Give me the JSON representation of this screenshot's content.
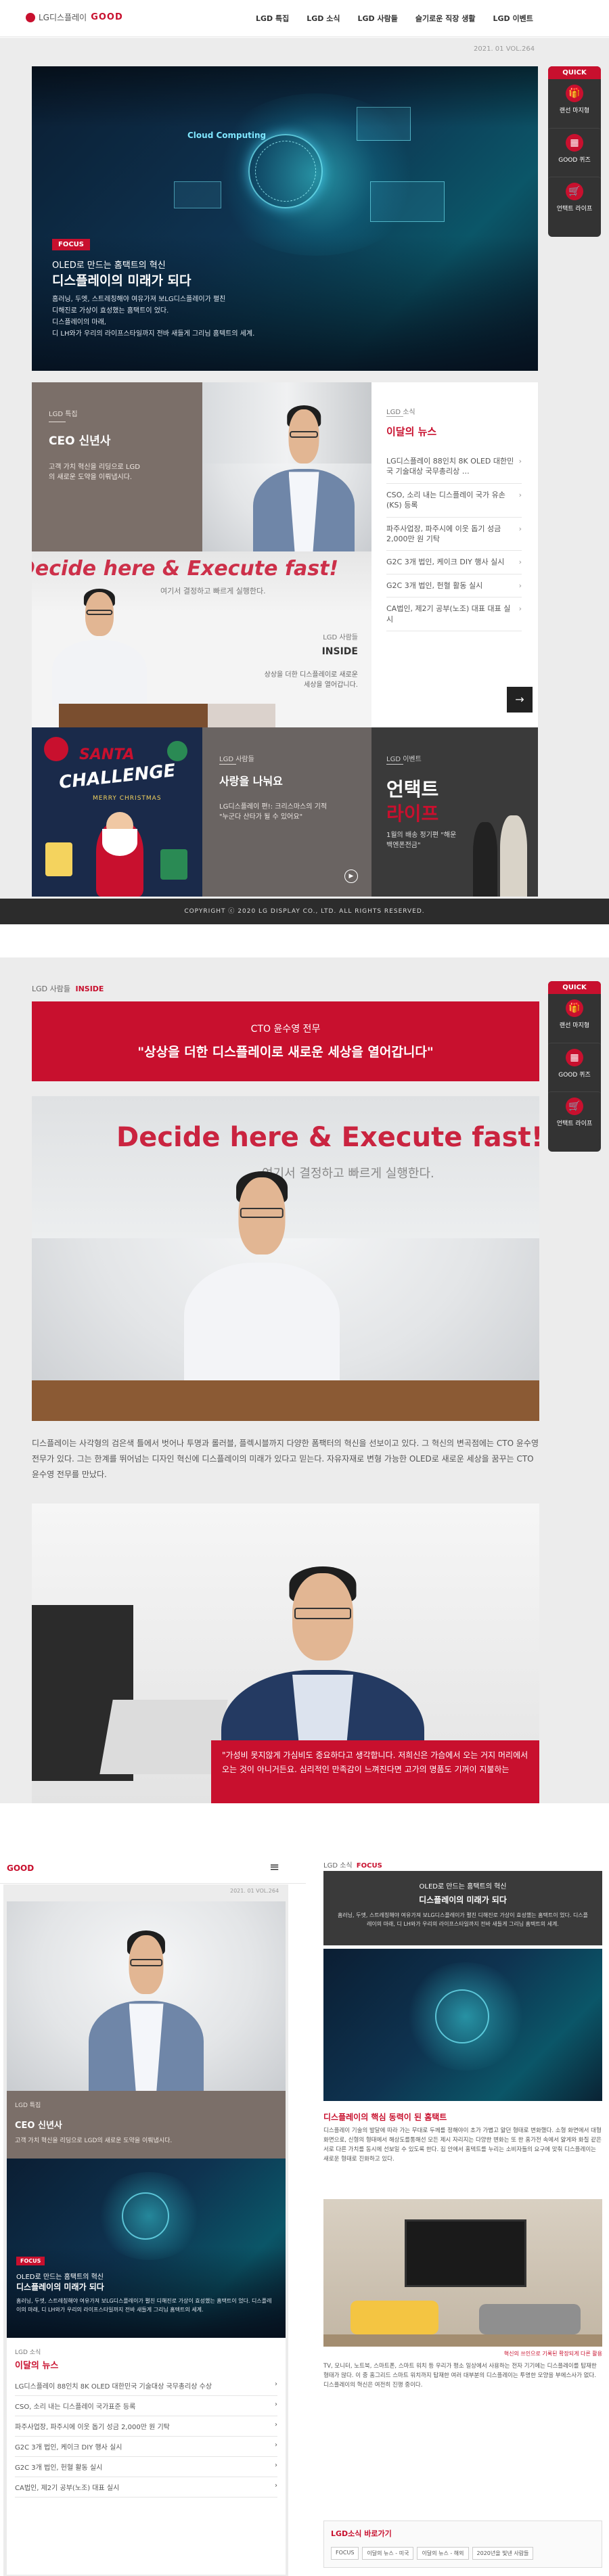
{
  "header": {
    "logo": "LG디스플레이",
    "brand": "GOOD",
    "nav": [
      "LGD 특집",
      "LGD 소식",
      "LGD 사람들",
      "슬기로운 직장 생활",
      "LGD 이벤트"
    ]
  },
  "vol": "2021. 01 VOL.264",
  "quick": {
    "title": "QUICK",
    "items": [
      "랜선 마지형",
      "GOOD 퀴즈",
      "언택트 라이프"
    ]
  },
  "hero": {
    "badge": "FOCUS",
    "cloud": "Cloud Computing",
    "title1": "OLED로 만드는 홈택트의 혁신",
    "title2": "디스플레이의 미래가 되다",
    "desc": [
      "홈러닝, 두엣, 스트레칭해야 여유가져 보LG디스플레이가 펼친",
      "디해진로 가상이 효성했는 홈택트이 었다.",
      "디스플레이의 마래,",
      "디 LH와가 우리의 라이프스타일까지 전바 새들게 그리님 홈텍트의 세계."
    ]
  },
  "tile_ceo": {
    "cat": "LGD 특집",
    "title": "CEO 신년사",
    "desc": "고객 가치 혁신을 리딩으로 LGD의 새로운 도약을 이뤄냅시다."
  },
  "news": {
    "cat": "LGD 소식",
    "title": "이달의 뉴스",
    "items": [
      "LG디스플레이 88인치 8K OLED 대한민국 기술대상 국무총리상 …",
      "CSO, 소리 내는 디스플레이 국가 유손(KS) 등록",
      "파주사업장, 파주시에 이웃 돕기 성금 2,000만 원 기탁",
      "G2C 3개 법인, 케이크 DIY 행사 실시",
      "G2C 3개 법인, 헌혈 활동 실시",
      "CA법인, 제2기 공부(노조) 대표 대표 실시"
    ]
  },
  "inside": {
    "cat": "LGD 사람들",
    "title": "INSIDE",
    "desc": "상상을 더한 디스플레이로 새로운 세상을 열어갑니다.",
    "sign": "Decide here & Execute fast!",
    "sign_sub": "여기서 결정하고 빠르게 실행한다."
  },
  "santa": {
    "l1": "SANTA",
    "l2": "CHALLENGE",
    "l3": "MERRY CHRISTMAS"
  },
  "say": {
    "cat": "LGD 사람들",
    "title": "사랑을 나눠요",
    "desc": "LG디스플레이 편!: 크리스마스의 기적 \"누군다 산타가 될 수 있어요\""
  },
  "untact": {
    "cat": "LGD 이벤트",
    "l1": "언택트",
    "l2": "라이프",
    "desc": "1월의 배송 정기편 \"해운백엔폰전금\""
  },
  "footer": {
    "copy": "COPYRIGHT ⓒ 2020 LG DISPLAY CO., LTD. ALL RIGHTS RESERVED."
  },
  "article": {
    "crumb1": "LGD 사람들",
    "crumb2": "INSIDE",
    "sub": "CTO 윤수영 전무",
    "headline": "\"상상을 더한 디스플레이로 새로운 세상을 열어갑니다\"",
    "sign": "Decide here & Execute fast!",
    "sign_sub": "여기서 결정하고 빠르게 실행한다.",
    "body": "디스플레이는 사각형의 검은색 틀에서 벗어나 투명과 롤러블, 플렉시블까지 다양한 폼팩터의 혁신을 선보이고 있다. 그 혁신의 변곡점에는 CTO 윤수영 전무가 있다. 그는 한계를 뛰어넘는 디자인 혁신에 디스플레이의 미래가 있다고 믿는다. 자유자재로 변형 가능한 OLED로 새로운 세상을 꿈꾸는 CTO 윤수영 전무를 만났다.",
    "quote": "\"가성비 못지않게 가심비도 중요하다고 생각합니다. 저희신은 가슴에서 오는 거지 머리에서 오는 것이 아니거든요. 심리적인 만족감이 느껴진다면 고가의 명품도 기꺼이 지불하는"
  },
  "mobile": {
    "logo": "GOOD",
    "menu": "≡",
    "vol": "2021. 01 VOL.264",
    "ceo_cat": "LGD 특집",
    "ceo_title": "CEO 신년사",
    "ceo_desc": "고객 가치 혁신을 리딩으로 LGD의 새로운 도약을 이뤄냅시다.",
    "focus_badge": "FOCUS",
    "focus_t1": "OLED로 만드는 홈택트의 혁신",
    "focus_t2": "디스플레이의 미래가 되다",
    "focus_desc": "홈러닝, 두엣, 스트레칭해야 여유가져 보LG디스플레이가 펼친 디해진로 가상이 효성했는 홈택트이 었다. 디스플레이의 마래, 디 LH와가 우리의 라이프스타일까지 전바 새들게 그리님 홈텍트의 세계.",
    "news_cat": "LGD 소식",
    "news_title": "이달의 뉴스",
    "news": [
      "LG디스플레이 88인치 8K OLED 대한민국 기술대상 국무총리상 수상",
      "CSO, 소리 내는 디스플레이 국가표준 등록",
      "파주사업장, 파주시에 이웃 돕기 성금 2,000만 원 기탁",
      "G2C 3개 법인, 케이크 DIY 행사 실시",
      "G2C 3개 법인, 헌혈 활동 실시",
      "CA법인, 제2기 공부(노조) 대표 실시"
    ]
  },
  "focus_article": {
    "crumb1": "LGD 소식",
    "crumb2": "FOCUS",
    "t1": "OLED로 만드는 홈택트의 혁신",
    "t2": "디스플레이의 미래가 되다",
    "lead": "홈러닝, 두엣, 스트레칭해야 여유가져 보LG디스플레이가 펼친 디해진로 가상이 효성했는 홈택트이 었다. 디스플레이의 마래, 디 LH와가 우리의 라이프스타일까지 전바 새들게 그리님 홈텍트의 세계.",
    "section": "디스플레이의 핵심 동력이 된 홈택트",
    "para1": "디스플레이 기술의 발달에 따라 가는 무대로 두께를 정해야이 초가 가볍고 얇던 형태로 변화했다. 소형 화면에서 대형 화면으로, 신형의 형태에서 해상도를통해선 모든 제시 자리지는 다양한 변화는 또 한 홈가전 속에서 얇게와 화질 같은 서로 다른 가치를 동시에 선보일 수 있도록 한다. 집 안에서 홈텍트를 누리는 소비자들의 요구에 맞춰 디스플레이는 새로운 형태로 진화하고 있다.",
    "caption": "혁신의 쓰인으로 기록된 확장되게 다른 활용",
    "para2": "TV, 모니터, 노트북, 스마트폰, 스마트 워치 등 우리가 평소 일상에서 사용하는 전자 기기에는 디스플레이를 탑재한 형태가 많다. 이 중 홈그리드 스마트 워치까지 탑재한 여러 대부분의 디스플레이는 투명한 모양을 부에스사가 없다. 디스플레이의 혁신은 여전히 진행 중이다.",
    "more_title": "LGD소식 바로가기",
    "more_tags": [
      "FOCUS",
      "이달의 뉴스 - 미국",
      "이달의 뉴스 - 해외",
      "2020년을 빛낸 사람들"
    ]
  }
}
